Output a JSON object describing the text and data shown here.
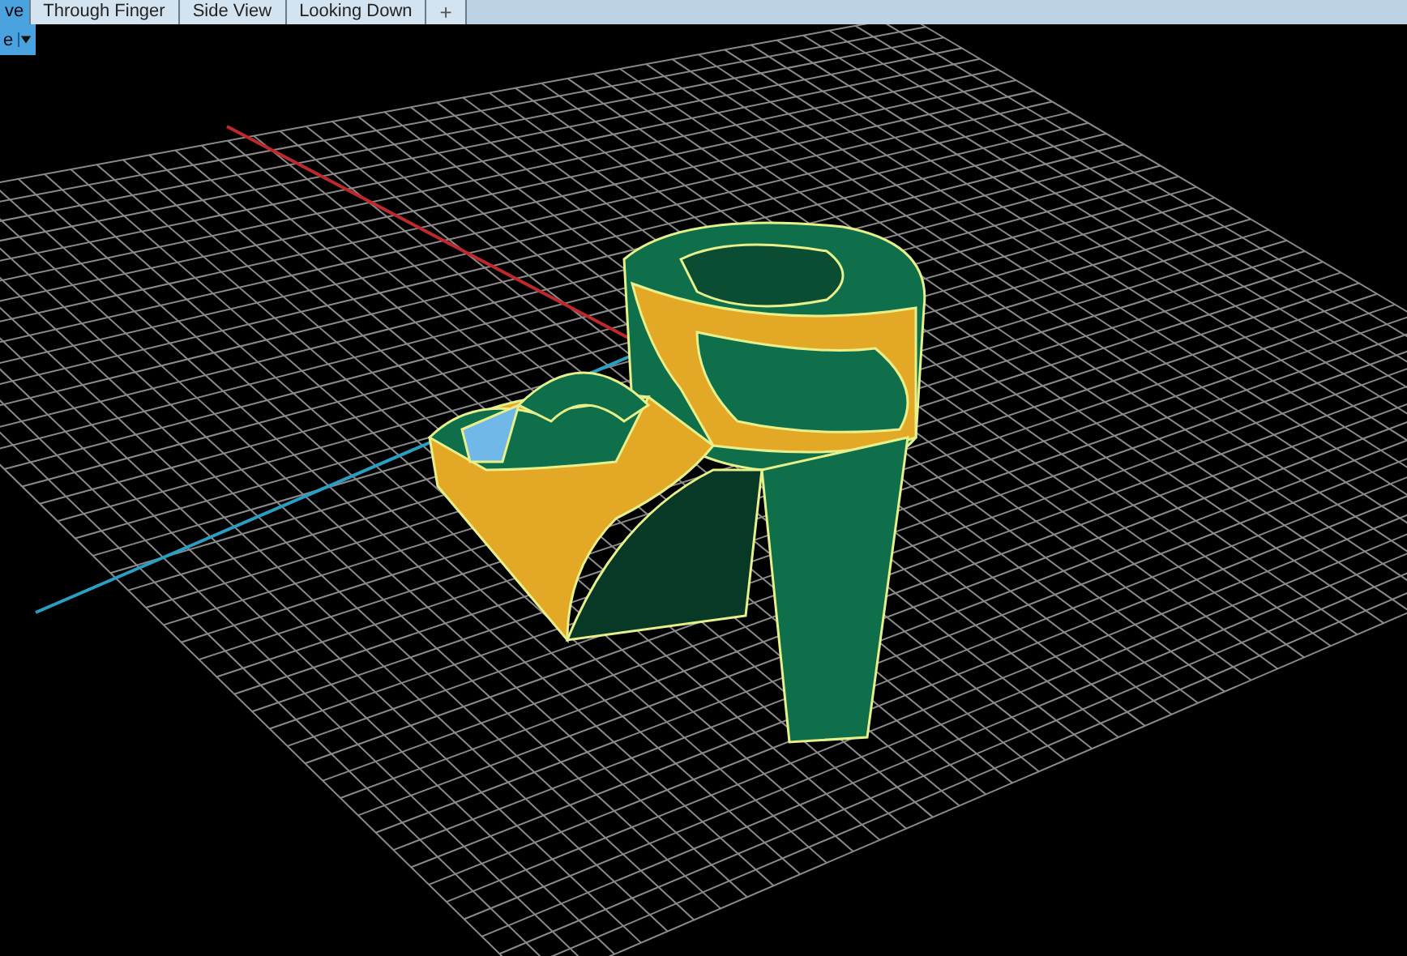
{
  "tabs": [
    {
      "label": "ve",
      "selected": true
    },
    {
      "label": "Through Finger",
      "selected": false
    },
    {
      "label": "Side View",
      "selected": false
    },
    {
      "label": "Looking Down",
      "selected": false
    }
  ],
  "add_tab": "+",
  "viewport": {
    "label": "e"
  }
}
